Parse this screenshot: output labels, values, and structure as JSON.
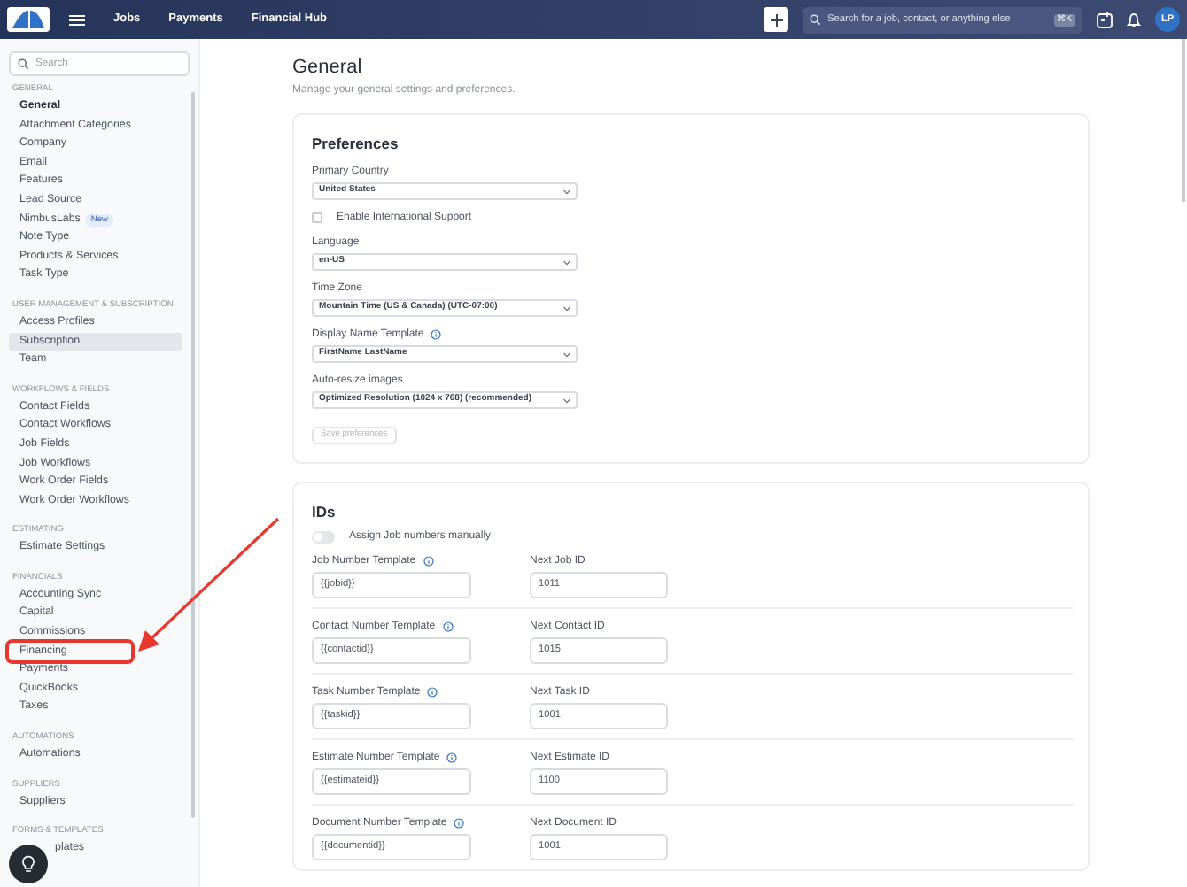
{
  "navbar": {
    "nav_links": [
      {
        "label": "Jobs"
      },
      {
        "label": "Payments"
      },
      {
        "label": "Financial Hub"
      }
    ],
    "search": {
      "placeholder": "Search for a job, contact, or anything else",
      "shortcut": "⌘K"
    },
    "avatar": "LP"
  },
  "sidebar": {
    "search": {
      "placeholder": "Search"
    },
    "sections": [
      {
        "title": "GENERAL",
        "items": [
          {
            "label": "General",
            "selected": true,
            "hovered": false,
            "highlighted": false
          },
          {
            "label": "Attachment Categories",
            "selected": false,
            "hovered": false,
            "highlighted": false
          },
          {
            "label": "Company",
            "selected": false,
            "hovered": false,
            "highlighted": false
          },
          {
            "label": "Email",
            "selected": false,
            "hovered": false,
            "highlighted": false
          },
          {
            "label": "Features",
            "selected": false,
            "hovered": false,
            "highlighted": false
          },
          {
            "label": "Lead Source",
            "selected": false,
            "hovered": false,
            "highlighted": false
          },
          {
            "label": "NimbusLabs",
            "badge": "New",
            "selected": false,
            "hovered": false,
            "highlighted": false
          },
          {
            "label": "Note Type",
            "selected": false,
            "hovered": false,
            "highlighted": false
          },
          {
            "label": "Products & Services",
            "selected": false,
            "hovered": false,
            "highlighted": false
          },
          {
            "label": "Task Type",
            "selected": false,
            "hovered": false,
            "highlighted": false
          }
        ]
      },
      {
        "title": "USER MANAGEMENT & SUBSCRIPTION",
        "items": [
          {
            "label": "Access Profiles",
            "selected": false,
            "hovered": false,
            "highlighted": false
          },
          {
            "label": "Subscription",
            "selected": false,
            "hovered": true,
            "highlighted": false
          },
          {
            "label": "Team",
            "selected": false,
            "hovered": false,
            "highlighted": false
          }
        ]
      },
      {
        "title": "WORKFLOWS & FIELDS",
        "items": [
          {
            "label": "Contact Fields",
            "selected": false,
            "hovered": false,
            "highlighted": false
          },
          {
            "label": "Contact Workflows",
            "selected": false,
            "hovered": false,
            "highlighted": false
          },
          {
            "label": "Job Fields",
            "selected": false,
            "hovered": false,
            "highlighted": false
          },
          {
            "label": "Job Workflows",
            "selected": false,
            "hovered": false,
            "highlighted": false
          },
          {
            "label": "Work Order Fields",
            "selected": false,
            "hovered": false,
            "highlighted": false
          },
          {
            "label": "Work Order Workflows",
            "selected": false,
            "hovered": false,
            "highlighted": false
          }
        ]
      },
      {
        "title": "ESTIMATING",
        "items": [
          {
            "label": "Estimate Settings",
            "selected": false,
            "hovered": false,
            "highlighted": false
          }
        ]
      },
      {
        "title": "FINANCIALS",
        "items": [
          {
            "label": "Accounting Sync",
            "selected": false,
            "hovered": false,
            "highlighted": false
          },
          {
            "label": "Capital",
            "selected": false,
            "hovered": false,
            "highlighted": false
          },
          {
            "label": "Commissions",
            "selected": false,
            "hovered": false,
            "highlighted": false
          },
          {
            "label": "Financing",
            "selected": false,
            "hovered": false,
            "highlighted": true
          },
          {
            "label": "Payments",
            "selected": false,
            "hovered": false,
            "highlighted": false
          },
          {
            "label": "QuickBooks",
            "selected": false,
            "hovered": false,
            "highlighted": false
          },
          {
            "label": "Taxes",
            "selected": false,
            "hovered": false,
            "highlighted": false
          }
        ]
      },
      {
        "title": "AUTOMATIONS",
        "items": [
          {
            "label": "Automations",
            "selected": false,
            "hovered": false,
            "highlighted": false
          }
        ]
      },
      {
        "title": "SUPPLIERS",
        "items": [
          {
            "label": "Suppliers",
            "selected": false,
            "hovered": false,
            "highlighted": false
          }
        ]
      },
      {
        "title": "FORMS & TEMPLATES",
        "items": [
          {
            "label": "plates",
            "selected": false,
            "hovered": false,
            "highlighted": false
          }
        ]
      }
    ]
  },
  "page": {
    "title": "General",
    "subtitle": "Manage your general settings and preferences."
  },
  "preferences": {
    "title": "Preferences",
    "fields": [
      {
        "kind": "select",
        "label": "Primary Country",
        "value": "United States",
        "info": false
      },
      {
        "kind": "checkbox",
        "label": "Enable International Support",
        "checked": false
      },
      {
        "kind": "select",
        "label": "Language",
        "value": "en-US",
        "info": false
      },
      {
        "kind": "select",
        "label": "Time Zone",
        "value": "Mountain Time (US & Canada) (UTC-07:00)",
        "info": false
      },
      {
        "kind": "select",
        "label": "Display Name Template",
        "value": "FirstName LastName",
        "info": true
      },
      {
        "kind": "select",
        "label": "Auto-resize images",
        "value": "Optimized Resolution (1024 x 768) (recommended)",
        "info": false
      }
    ],
    "save_button": {
      "label": "Save preferences",
      "disabled": true
    }
  },
  "ids": {
    "title": "IDs",
    "toggle": {
      "label": "Assign Job numbers manually",
      "on": false
    },
    "rows": [
      {
        "template_label": "Job Number Template",
        "template_value": "{{jobid}}",
        "next_label": "Next Job ID",
        "next_value": "1011"
      },
      {
        "template_label": "Contact Number Template",
        "template_value": "{{contactid}}",
        "next_label": "Next Contact ID",
        "next_value": "1015"
      },
      {
        "template_label": "Task Number Template",
        "template_value": "{{taskid}}",
        "next_label": "Next Task ID",
        "next_value": "1001"
      },
      {
        "template_label": "Estimate Number Template",
        "template_value": "{{estimateid}}",
        "next_label": "Next Estimate ID",
        "next_value": "1100"
      },
      {
        "template_label": "Document Number Template",
        "template_value": "{{documentid}}",
        "next_label": "Next Document ID",
        "next_value": "1001"
      }
    ]
  }
}
